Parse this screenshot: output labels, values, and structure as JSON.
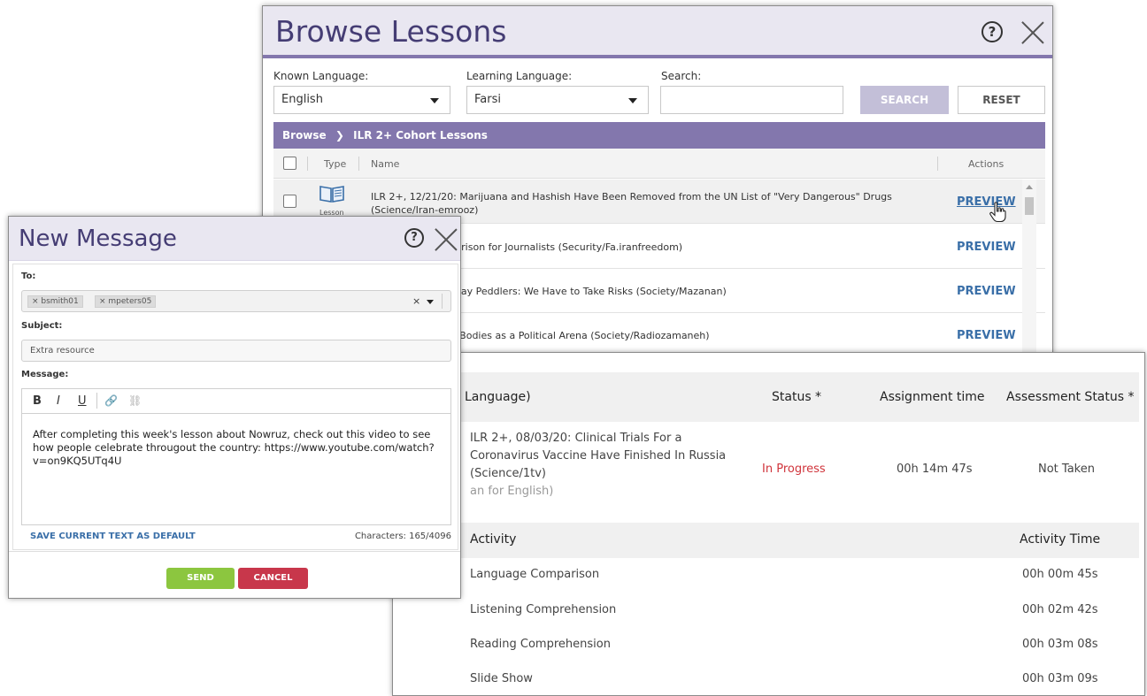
{
  "browse": {
    "title": "Browse Lessons",
    "known_language_label": "Known Language:",
    "known_language_value": "English",
    "learning_language_label": "Learning Language:",
    "learning_language_value": "Farsi",
    "search_label": "Search:",
    "search_value": "",
    "search_button": "SEARCH",
    "reset_button": "RESET",
    "breadcrumb_root": "Browse",
    "breadcrumb_sep": "❯",
    "breadcrumb_current": "ILR 2+ Cohort Lessons",
    "columns": {
      "type": "Type",
      "name": "Name",
      "actions": "Actions"
    },
    "lesson_type_label": "Lesson",
    "rows": [
      {
        "name": "ILR 2+, 12/21/20: Marijuana and Hashish Have Been Removed from the UN List of \"Very Dangerous\" Drugs (Science/Iran-emrooz)",
        "action": "PREVIEW"
      },
      {
        "name": "an Is the Largest Prison for Journalists (Security/Fa.iranfreedom)",
        "action": "PREVIEW"
      },
      {
        "name": "hran Female Subway Peddlers: We Have to Take Risks (Society/Mazanan)",
        "action": "PREVIEW"
      },
      {
        "name": "portion: Women's Bodies as a Political Arena (Society/Radiozamaneh)",
        "action": "PREVIEW"
      }
    ]
  },
  "report": {
    "header": {
      "lesson_col": "Language)",
      "status_col": "Status *",
      "time_col": "Assignment time",
      "assessment_col": "Assessment Status *"
    },
    "lesson": {
      "title_lines": [
        "ILR 2+, 08/03/20: Clinical Trials For a",
        "Coronavirus Vaccine Have Finished In Russia",
        "(Science/1tv)"
      ],
      "language_note": "an for English)",
      "status": "In Progress",
      "time": "00h 14m 47s",
      "assessment": "Not Taken"
    },
    "activity_header": {
      "activity": "Activity",
      "time": "Activity Time"
    },
    "activities": [
      {
        "name": "Language Comparison",
        "time": "00h 00m 45s"
      },
      {
        "name": "Listening Comprehension",
        "time": "00h 02m 42s"
      },
      {
        "name": "Reading Comprehension",
        "time": "00h 03m 08s"
      },
      {
        "name": "Slide Show",
        "time": "00h 03m 09s"
      }
    ],
    "colors": {
      "status_in_progress": "#d0343b"
    }
  },
  "message": {
    "title": "New Message",
    "to_label": "To:",
    "recipients": [
      "× bsmith01",
      "× mpeters05"
    ],
    "clear_symbol": "×",
    "subject_label": "Subject:",
    "subject_value": "Extra resource",
    "message_label": "Message:",
    "toolbar": {
      "bold": "B",
      "italic": "I",
      "underline": "U",
      "link": "🔗",
      "unlink": "⛓"
    },
    "body": "After completing this week's lesson about Nowruz, check out this video to see how people celebrate througout the country: https://www.youtube.com/watch?v=on9KQ5UTq4U",
    "save_default": "SAVE CURRENT TEXT AS DEFAULT",
    "characters": "Characters: 165/4096",
    "send_button": "SEND",
    "cancel_button": "CANCEL"
  },
  "colors": {
    "accent_purple": "#8377ad",
    "title_purple": "#453d74",
    "link_blue": "#3a6fa8",
    "send_green": "#8cc63f",
    "cancel_red": "#c8374b"
  }
}
